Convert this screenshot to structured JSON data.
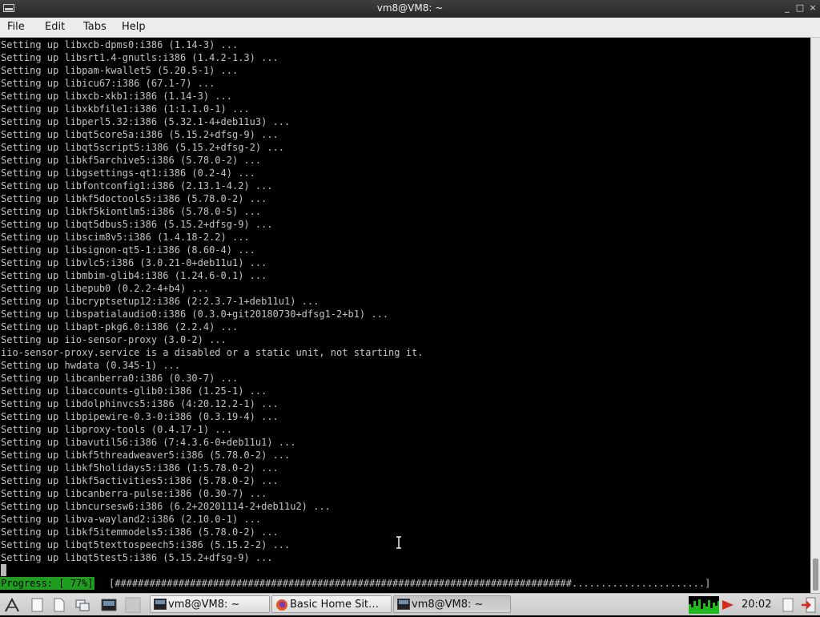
{
  "window": {
    "title": "vm8@VM8: ~",
    "minimize_glyph": "_",
    "maximize_glyph": "□",
    "close_glyph": "×"
  },
  "menu": [
    "File",
    "Edit",
    "Tabs",
    "Help"
  ],
  "terminal": {
    "lines": [
      "Setting up libxcb-dpms0:i386 (1.14-3) ...",
      "Setting up libsrt1.4-gnutls:i386 (1.4.2-1.3) ...",
      "Setting up libpam-kwallet5 (5.20.5-1) ...",
      "Setting up libicu67:i386 (67.1-7) ...",
      "Setting up libxcb-xkb1:i386 (1.14-3) ...",
      "Setting up libxkbfile1:i386 (1:1.1.0-1) ...",
      "Setting up libperl5.32:i386 (5.32.1-4+deb11u3) ...",
      "Setting up libqt5core5a:i386 (5.15.2+dfsg-9) ...",
      "Setting up libqt5script5:i386 (5.15.2+dfsg-2) ...",
      "Setting up libkf5archive5:i386 (5.78.0-2) ...",
      "Setting up libgsettings-qt1:i386 (0.2-4) ...",
      "Setting up libfontconfig1:i386 (2.13.1-4.2) ...",
      "Setting up libkf5doctools5:i386 (5.78.0-2) ...",
      "Setting up libkf5kiontlm5:i386 (5.78.0-5) ...",
      "Setting up libqt5dbus5:i386 (5.15.2+dfsg-9) ...",
      "Setting up libscim8v5:i386 (1.4.18-2.2) ...",
      "Setting up libsignon-qt5-1:i386 (8.60-4) ...",
      "Setting up libvlc5:i386 (3.0.21-0+deb11u1) ...",
      "Setting up libmbim-glib4:i386 (1.24.6-0.1) ...",
      "Setting up libepub0 (0.2.2-4+b4) ...",
      "Setting up libcryptsetup12:i386 (2:2.3.7-1+deb11u1) ...",
      "Setting up libspatialaudio0:i386 (0.3.0+git20180730+dfsg1-2+b1) ...",
      "Setting up libapt-pkg6.0:i386 (2.2.4) ...",
      "Setting up iio-sensor-proxy (3.0-2) ...",
      "iio-sensor-proxy.service is a disabled or a static unit, not starting it.",
      "Setting up hwdata (0.345-1) ...",
      "Setting up libcanberra0:i386 (0.30-7) ...",
      "Setting up libaccounts-glib0:i386 (1.25-1) ...",
      "Setting up libdolphinvcs5:i386 (4:20.12.2-1) ...",
      "Setting up libpipewire-0.3-0:i386 (0.3.19-4) ...",
      "Setting up libproxy-tools (0.4.17-1) ...",
      "Setting up libavutil56:i386 (7:4.3.6-0+deb11u1) ...",
      "Setting up libkf5threadweaver5:i386 (5.78.0-2) ...",
      "Setting up libkf5holidays5:i386 (1:5.78.0-2) ...",
      "Setting up libkf5activities5:i386 (5.78.0-2) ...",
      "Setting up libcanberra-pulse:i386 (0.30-7) ...",
      "Setting up libncursesw6:i386 (6.2+20201114-2+deb11u2) ...",
      "Setting up libva-wayland2:i386 (2.10.0-1) ...",
      "Setting up libkf5itemmodels5:i386 (5.78.0-2) ...",
      "Setting up libqt5texttospeech5:i386 (5.15.2-2) ...",
      "Setting up libqt5test5:i386 (5.15.2+dfsg-9) ..."
    ],
    "progress_label": "Progress: [ 77%]",
    "progress_bar": "[###############################################################################.......................]",
    "progress_percent": 77
  },
  "taskbar": {
    "launchers": [
      "start-menu-icon",
      "file-manager-icon",
      "document-icon",
      "window-switcher-icon",
      "terminal-launcher-icon",
      "blank-launcher-icon"
    ],
    "tasks": [
      {
        "label": "vm8@VM8: ~",
        "icon": "terminal-icon",
        "active": false
      },
      {
        "label": "Basic Home Sit…",
        "icon": "firefox-icon",
        "active": false
      },
      {
        "label": "vm8@VM8: ~",
        "icon": "terminal-icon",
        "active": true
      }
    ],
    "clock": "20:02"
  }
}
